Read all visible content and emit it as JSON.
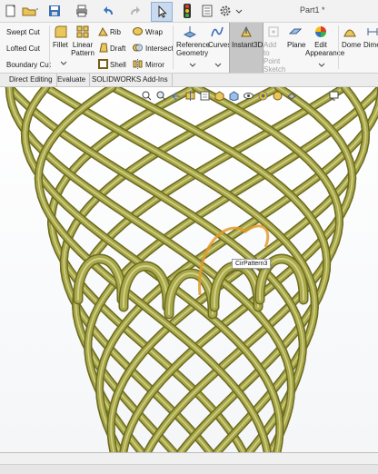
{
  "window": {
    "document_title": "Part1 *"
  },
  "ribbon": {
    "features": {
      "swept_cut": "Swept Cut",
      "lofted_cut": "Lofted Cut",
      "boundary_cut": "Boundary Cut",
      "fillet": "Fillet",
      "linear_pattern": "Linear Pattern",
      "rib": "Rib",
      "draft": "Draft",
      "shell": "Shell",
      "wrap": "Wrap",
      "intersect": "Intersect",
      "mirror": "Mirror",
      "reference_geometry": "Reference Geometry",
      "curves": "Curves",
      "instant3d": "Instant3D",
      "add_to_point_sketch": "Add to Point Sketch",
      "plane": "Plane",
      "edit_appearance": "Edit Appearance",
      "dome": "Dome",
      "dime": "Dime"
    }
  },
  "tabs": [
    "Direct Editing",
    "Evaluate",
    "SOLIDWORKS Add-Ins"
  ],
  "viewport": {
    "tooltip": "CirPattern3"
  },
  "colors": {
    "model": "#a9a84a",
    "model_dark": "#6b6b22",
    "selection": "#e39a2a",
    "accent": "#5b9bd5"
  }
}
